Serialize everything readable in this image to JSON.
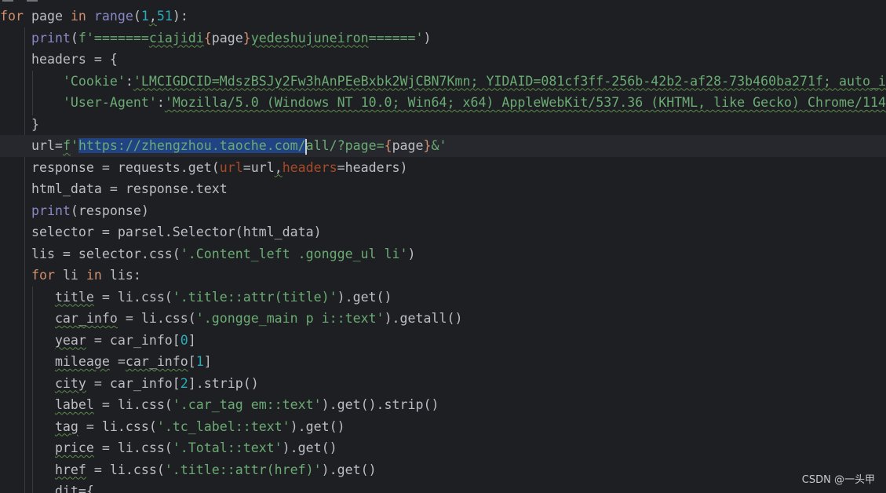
{
  "code": {
    "lines": [
      {
        "tokens": [
          {
            "text": "for",
            "cls": "kw"
          },
          {
            "text": " page ",
            "cls": ""
          },
          {
            "text": "in",
            "cls": "kw"
          },
          {
            "text": " ",
            "cls": ""
          },
          {
            "text": "range",
            "cls": "bi"
          },
          {
            "text": "(",
            "cls": ""
          },
          {
            "text": "1",
            "cls": "num"
          },
          {
            "text": ",",
            "cls": "wavy"
          },
          {
            "text": "51",
            "cls": "num"
          },
          {
            "text": "):",
            "cls": ""
          }
        ]
      },
      {
        "tokens": [
          {
            "text": "    ",
            "cls": ""
          },
          {
            "text": "print",
            "cls": "bi"
          },
          {
            "text": "(",
            "cls": ""
          },
          {
            "text": "f'=======",
            "cls": "str"
          },
          {
            "text": "ciajidi",
            "cls": "str typo"
          },
          {
            "text": "{",
            "cls": "br"
          },
          {
            "text": "page",
            "cls": "pv"
          },
          {
            "text": "}",
            "cls": "br"
          },
          {
            "text": "yedeshujuneiron",
            "cls": "str typo"
          },
          {
            "text": "======'",
            "cls": "str"
          },
          {
            "text": ")",
            "cls": ""
          }
        ]
      },
      {
        "tokens": [
          {
            "text": "    headers = {",
            "cls": ""
          }
        ]
      },
      {
        "tokens": [
          {
            "text": "        ",
            "cls": ""
          },
          {
            "text": "'Cookie'",
            "cls": "str"
          },
          {
            "text": ":",
            "cls": ""
          },
          {
            "text": "'LMCIGDCID=MdszBSJy2Fw3hAnPEeBxbk2WjCBN7Kmn; YIDAID=081cf3ff-256b-42b2-af28-73b460ba271f; auto_i",
            "cls": "str wavy"
          }
        ]
      },
      {
        "tokens": [
          {
            "text": "        ",
            "cls": ""
          },
          {
            "text": "'User-Agent'",
            "cls": "str"
          },
          {
            "text": ":",
            "cls": ""
          },
          {
            "text": "'Mozilla/5.0 (Windows NT 10.0; Win64; x64) AppleWebKit/537.36 (KHTML, like Gecko) Chrome/114",
            "cls": "str wavy"
          }
        ]
      },
      {
        "tokens": [
          {
            "text": "    }",
            "cls": ""
          }
        ]
      },
      {
        "current": true,
        "tokens": [
          {
            "text": "    url=",
            "cls": ""
          },
          {
            "text": "f",
            "cls": "str wavy"
          },
          {
            "text": "'",
            "cls": "str"
          },
          {
            "text": "https://zhengzhou.taoche.com/",
            "cls": "str sel"
          },
          {
            "text": "",
            "cls": "caret"
          },
          {
            "text": "all/?page=",
            "cls": "str"
          },
          {
            "text": "{",
            "cls": "br"
          },
          {
            "text": "page",
            "cls": "pv"
          },
          {
            "text": "}",
            "cls": "br"
          },
          {
            "text": "&'",
            "cls": "str"
          }
        ]
      },
      {
        "tokens": [
          {
            "text": "    response = requests.get(",
            "cls": ""
          },
          {
            "text": "url",
            "cls": "param"
          },
          {
            "text": "=url",
            "cls": ""
          },
          {
            "text": ",",
            "cls": "wavy"
          },
          {
            "text": "headers",
            "cls": "param"
          },
          {
            "text": "=headers)",
            "cls": ""
          }
        ]
      },
      {
        "tokens": [
          {
            "text": "    html_data = response.text",
            "cls": ""
          }
        ]
      },
      {
        "tokens": [
          {
            "text": "    ",
            "cls": ""
          },
          {
            "text": "print",
            "cls": "bi"
          },
          {
            "text": "(response)",
            "cls": ""
          }
        ]
      },
      {
        "tokens": [
          {
            "text": "    selector = parsel.Selector(html_data)",
            "cls": ""
          }
        ]
      },
      {
        "tokens": [
          {
            "text": "    lis = selector.css(",
            "cls": ""
          },
          {
            "text": "'.Content_left .gongge_ul li'",
            "cls": "str"
          },
          {
            "text": ")",
            "cls": ""
          }
        ]
      },
      {
        "tokens": [
          {
            "text": "    ",
            "cls": ""
          },
          {
            "text": "for",
            "cls": "kw"
          },
          {
            "text": " li ",
            "cls": ""
          },
          {
            "text": "in",
            "cls": "kw"
          },
          {
            "text": " lis:",
            "cls": ""
          }
        ]
      },
      {
        "tokens": [
          {
            "text": "       ",
            "cls": ""
          },
          {
            "text": "title",
            "cls": "wavy"
          },
          {
            "text": " = li.css(",
            "cls": ""
          },
          {
            "text": "'.title::attr(title)'",
            "cls": "str"
          },
          {
            "text": ").get()",
            "cls": ""
          }
        ]
      },
      {
        "tokens": [
          {
            "text": "       ",
            "cls": ""
          },
          {
            "text": "car_info",
            "cls": "wavy"
          },
          {
            "text": " = li.css(",
            "cls": ""
          },
          {
            "text": "'.gongge_main p i::text'",
            "cls": "str"
          },
          {
            "text": ").getall()",
            "cls": ""
          }
        ]
      },
      {
        "tokens": [
          {
            "text": "       ",
            "cls": ""
          },
          {
            "text": "year",
            "cls": "wavy"
          },
          {
            "text": " = car_info[",
            "cls": ""
          },
          {
            "text": "0",
            "cls": "num"
          },
          {
            "text": "]",
            "cls": ""
          }
        ]
      },
      {
        "tokens": [
          {
            "text": "       ",
            "cls": ""
          },
          {
            "text": "mileage",
            "cls": "wavy"
          },
          {
            "text": " =",
            "cls": ""
          },
          {
            "text": "car_info",
            "cls": "wavy"
          },
          {
            "text": "[",
            "cls": ""
          },
          {
            "text": "1",
            "cls": "num"
          },
          {
            "text": "]",
            "cls": ""
          }
        ]
      },
      {
        "tokens": [
          {
            "text": "       ",
            "cls": ""
          },
          {
            "text": "city",
            "cls": "wavy"
          },
          {
            "text": " = car_info[",
            "cls": ""
          },
          {
            "text": "2",
            "cls": "num"
          },
          {
            "text": "].strip()",
            "cls": ""
          }
        ]
      },
      {
        "tokens": [
          {
            "text": "       ",
            "cls": ""
          },
          {
            "text": "label",
            "cls": "wavy"
          },
          {
            "text": " = li.css(",
            "cls": ""
          },
          {
            "text": "'.car_tag em::text'",
            "cls": "str"
          },
          {
            "text": ").get().strip()",
            "cls": ""
          }
        ]
      },
      {
        "tokens": [
          {
            "text": "       ",
            "cls": ""
          },
          {
            "text": "tag",
            "cls": "wavy"
          },
          {
            "text": " = li.css(",
            "cls": ""
          },
          {
            "text": "'.tc_label::text'",
            "cls": "str"
          },
          {
            "text": ").get()",
            "cls": ""
          }
        ]
      },
      {
        "tokens": [
          {
            "text": "       ",
            "cls": ""
          },
          {
            "text": "price",
            "cls": "wavy"
          },
          {
            "text": " = li.css(",
            "cls": ""
          },
          {
            "text": "'.Total::text'",
            "cls": "str"
          },
          {
            "text": ").get()",
            "cls": ""
          }
        ]
      },
      {
        "tokens": [
          {
            "text": "       ",
            "cls": ""
          },
          {
            "text": "href",
            "cls": "wavy"
          },
          {
            "text": " = li.css(",
            "cls": ""
          },
          {
            "text": "'.title::attr(href)'",
            "cls": "str"
          },
          {
            "text": ").get()",
            "cls": ""
          }
        ]
      },
      {
        "tokens": [
          {
            "text": "       dit={",
            "cls": ""
          }
        ]
      }
    ]
  },
  "watermark": "CSDN @一头甲",
  "colors": {
    "background": "#1e1f22",
    "keyword": "#cf8e6d",
    "builtin": "#8888c6",
    "number": "#2aacb8",
    "string": "#6aab73",
    "selection": "#214283"
  }
}
